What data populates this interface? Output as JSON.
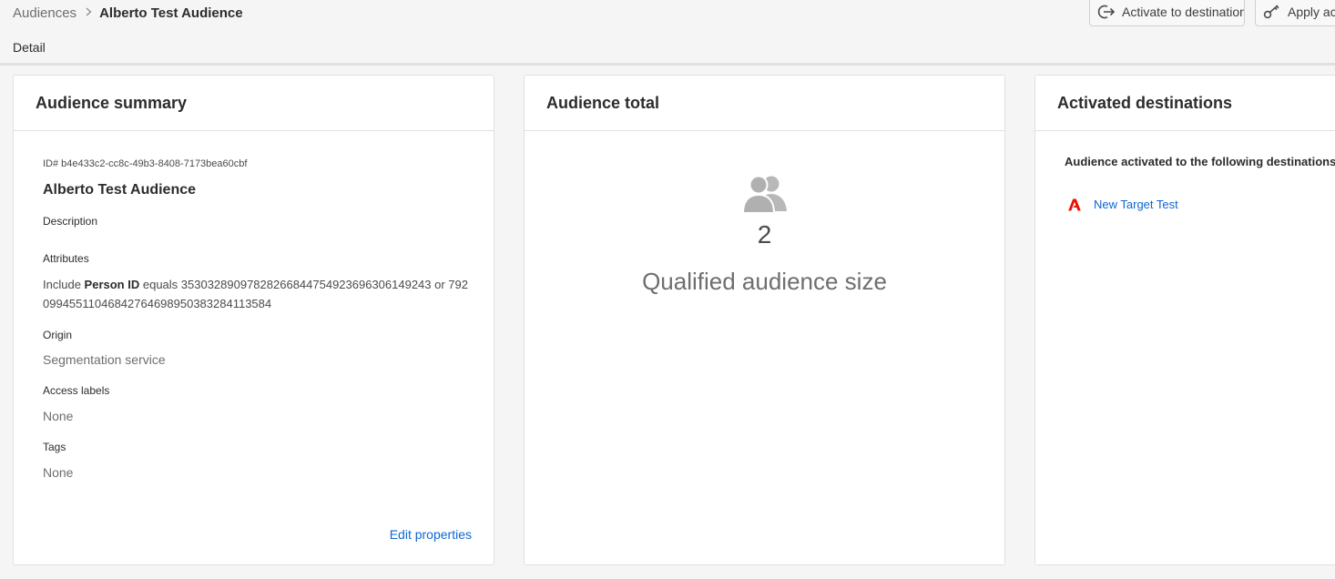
{
  "breadcrumb": {
    "parent": "Audiences",
    "current": "Alberto Test Audience"
  },
  "actions": {
    "activate_label": "Activate to destination",
    "apply_label": "Apply acc"
  },
  "tabs": [
    {
      "label": "Detail",
      "active": true
    }
  ],
  "summary": {
    "title": "Audience summary",
    "id_line": "ID# b4e433c2-cc8c-49b3-8408-7173bea60cbf",
    "name": "Alberto Test Audience",
    "description_label": "Description",
    "attributes_label": "Attributes",
    "attributes": {
      "prefix": "Include",
      "field": "Person ID",
      "rest": "equals 353032890978282668447549236963061492​43 or 79209945511046842764698950383284113584"
    },
    "origin_label": "Origin",
    "origin_value": "Segmentation service",
    "access_labels_label": "Access labels",
    "access_labels_value": "None",
    "tags_label": "Tags",
    "tags_value": "None",
    "edit_label": "Edit properties"
  },
  "total": {
    "title": "Audience total",
    "count": "2",
    "label": "Qualified audience size"
  },
  "destinations": {
    "title": "Activated destinations",
    "heading": "Audience activated to the following destinations",
    "items": [
      {
        "name": "New Target Test",
        "logo_color": "#eb1000"
      }
    ]
  },
  "colors": {
    "link": "#0d66d0",
    "background": "#f5f5f5",
    "adobe_red": "#eb1000"
  }
}
